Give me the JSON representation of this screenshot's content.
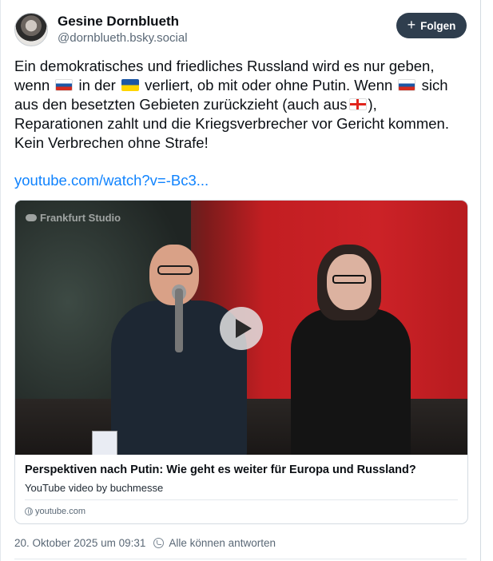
{
  "author": {
    "display_name": "Gesine Dornblueth",
    "handle": "@dornblueth.bsky.social"
  },
  "follow_button": {
    "label": "Folgen",
    "icon": "plus-icon"
  },
  "post": {
    "text_parts": {
      "p1": "Ein demokratisches und friedliches Russland wird es nur geben, wenn",
      "flag1": "russia-flag",
      "p2": "in der",
      "flag2": "ukraine-flag",
      "p3": "verliert, ob mit oder ohne Putin. Wenn",
      "flag3": "russia-flag",
      "p4": "sich aus den besetzten Gebieten zurückzieht (auch aus",
      "flag4": "georgia-flag",
      "p5": "), Reparationen zahlt und die Kriegsverbrecher vor Gericht kommen. Kein Verbrechen ohne Strafe!"
    },
    "link_text": "youtube.com/watch?v=-Bc3..."
  },
  "embed": {
    "thumbnail_watermark": "Frankfurt Studio",
    "title": "Perspektiven nach Putin: Wie geht es weiter für Europa und Russland?",
    "description": "YouTube video by buchmesse",
    "domain": "youtube.com"
  },
  "meta": {
    "timestamp": "20. Oktober 2025 um 09:31",
    "reply_setting": "Alle können antworten"
  },
  "colors": {
    "link": "#1083fe",
    "follow_button_bg": "#2f3e4e",
    "muted_text": "#5a6876"
  }
}
